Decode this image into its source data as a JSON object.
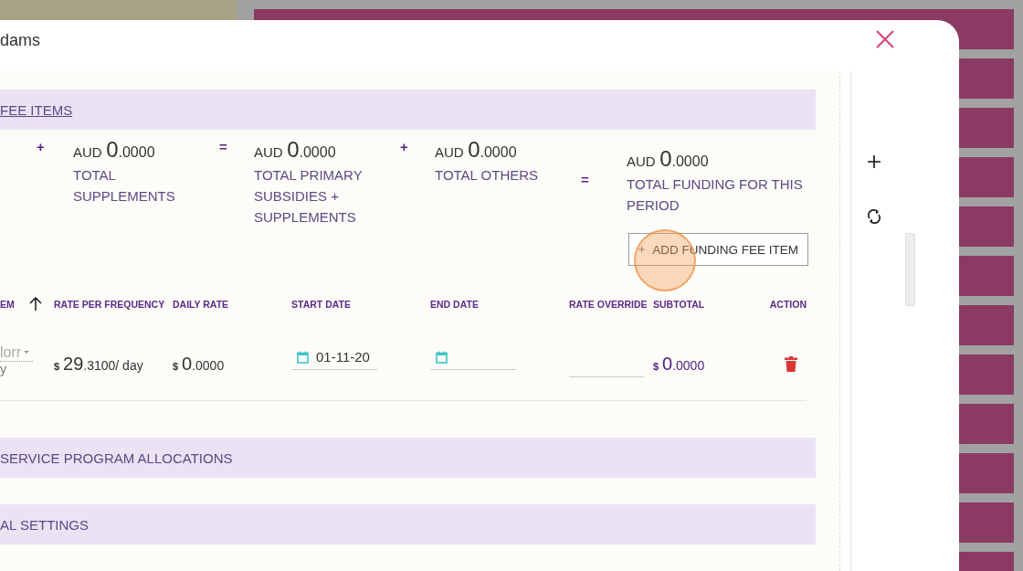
{
  "dialog": {
    "title": "dams"
  },
  "fee_section": {
    "header": "FEE ITEMS",
    "summary": [
      {
        "operator": "+",
        "currency": "AUD",
        "whole": "0",
        "decimals": ".0000",
        "label": "TOTAL SUPPLEMENTS"
      },
      {
        "operator": "=",
        "currency": "AUD",
        "whole": "0",
        "decimals": ".0000",
        "label": "TOTAL PRIMARY SUBSIDIES + SUPPLEMENTS"
      },
      {
        "operator": "+",
        "currency": "AUD",
        "whole": "0",
        "decimals": ".0000",
        "label": "TOTAL OTHERS"
      },
      {
        "operator": "=",
        "currency": "AUD",
        "whole": "0",
        "decimals": ".0000",
        "label": "TOTAL FUNDING FOR THIS PERIOD"
      }
    ],
    "add_button": {
      "label": "ADD FUNDING FEE ITEM",
      "click_highlight": true
    },
    "table": {
      "columns": [
        "EM",
        "RATE PER FREQUENCY",
        "DAILY RATE",
        "START DATE",
        "END DATE",
        "RATE OVERRIDE",
        "SUBTOTAL",
        "ACTION"
      ],
      "rows": [
        {
          "cells": [
            {
              "kind": "dropdown",
              "value": "lorr",
              "sub": "y"
            },
            {
              "kind": "money",
              "currency": "$",
              "whole": "29",
              "decimals": ".3100",
              "unit": "/ day"
            },
            {
              "kind": "money",
              "currency": "$",
              "whole": "0",
              "decimals": ".0000"
            },
            {
              "kind": "date",
              "value": "01-11-20"
            },
            {
              "kind": "date"
            },
            {
              "kind": "input"
            },
            {
              "kind": "total",
              "currency": "$",
              "whole": "0",
              "decimals": ".0000"
            },
            {
              "kind": "delete"
            }
          ]
        }
      ]
    }
  },
  "sections": [
    {
      "header": "SERVICE PROGRAM ALLOCATIONS"
    },
    {
      "header": "AL SETTINGS"
    }
  ]
}
